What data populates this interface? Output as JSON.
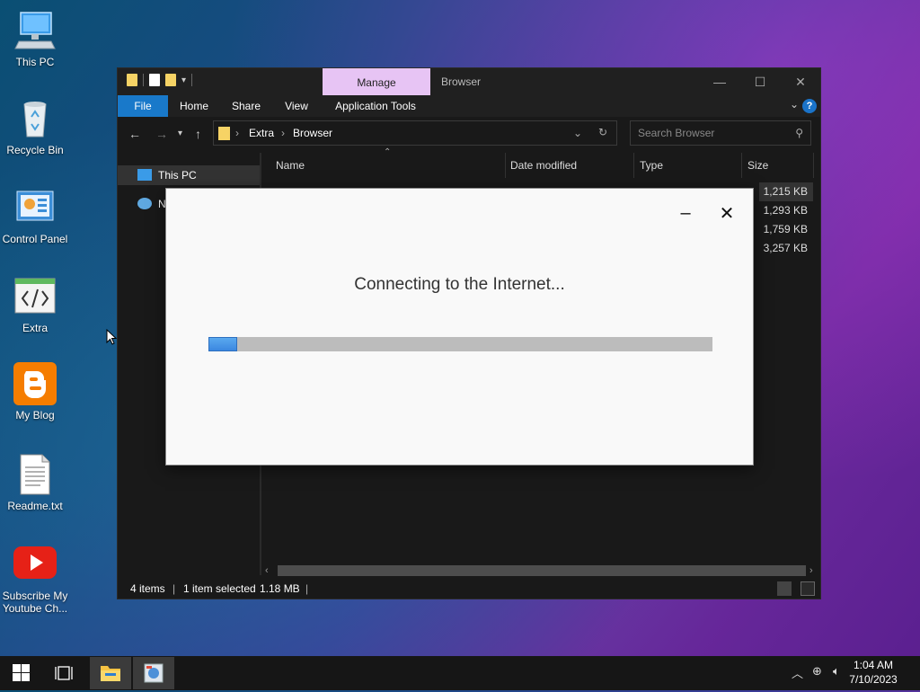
{
  "desktop": {
    "icons": [
      {
        "label": "This PC"
      },
      {
        "label": "Recycle Bin"
      },
      {
        "label": "Control Panel"
      },
      {
        "label": "Extra"
      },
      {
        "label": "My Blog"
      },
      {
        "label": "Readme.txt"
      },
      {
        "label": "Subscribe My Youtube Ch..."
      }
    ]
  },
  "explorer": {
    "title": "Browser",
    "manage_tab": "Manage",
    "ribbon_tabs": [
      "File",
      "Home",
      "Share",
      "View",
      "Application Tools"
    ],
    "breadcrumb": [
      "Extra",
      "Browser"
    ],
    "search_placeholder": "Search Browser",
    "nav_items": [
      "This PC",
      "N"
    ],
    "columns": [
      "Name",
      "Date modified",
      "Type",
      "Size"
    ],
    "sizes": [
      "1,215 KB",
      "1,293 KB",
      "1,759 KB",
      "3,257 KB"
    ],
    "status": {
      "items": "4 items",
      "selected": "1 item selected",
      "size": "1.18 MB"
    }
  },
  "dialog": {
    "message": "Connecting to the Internet...",
    "progress_fraction": 0.057
  },
  "taskbar": {
    "time": "1:04 AM",
    "date": "7/10/2023"
  },
  "colors": {
    "accent": "#1979ca",
    "manage_tab": "#e7c4f4",
    "progress_fill": "#3b87e0"
  }
}
